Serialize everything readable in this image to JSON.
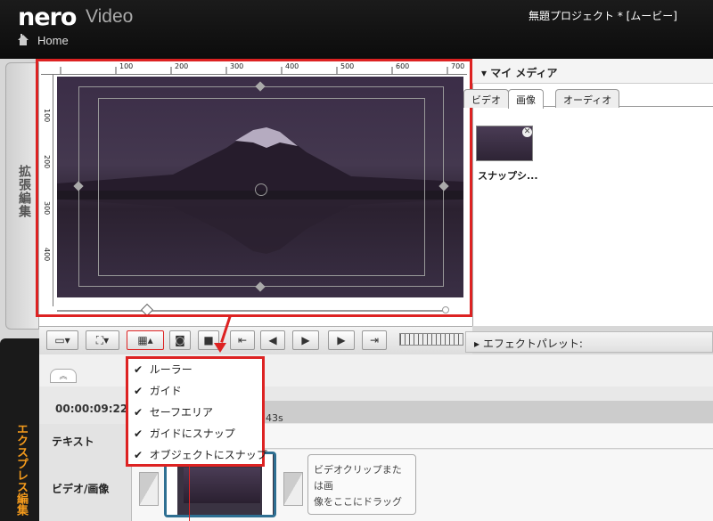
{
  "app": {
    "logo_brand": "nero",
    "logo_product": "Video",
    "project_title": "無題プロジェクト * [ムービー]",
    "home_label": "Home"
  },
  "side_tabs": {
    "top_label": "拡張編集",
    "bottom_label": "エクスプレス編集"
  },
  "preview": {
    "ruler_top_ticks": [
      "100",
      "200",
      "300",
      "400",
      "500",
      "600",
      "700"
    ],
    "ruler_left_ticks": [
      "100",
      "200",
      "300",
      "400"
    ]
  },
  "media": {
    "header": "マイ メディア",
    "tabs": [
      {
        "label": "ビデオ",
        "active": false
      },
      {
        "label": "画像",
        "active": true
      },
      {
        "label": "オーディオ",
        "active": false
      }
    ],
    "items": [
      {
        "label": "スナップシ..."
      }
    ]
  },
  "effects": {
    "label": "エフェクトパレット:"
  },
  "timeline": {
    "timecode": "00:00:09:22",
    "ruler_time": "43s",
    "tracks": [
      "テキスト",
      "ビデオ/画像"
    ],
    "drop_hint_line1": "ビデオクリップまたは画",
    "drop_hint_line2": "像をここにドラッグ"
  },
  "context_menu": {
    "items": [
      {
        "label": "ルーラー",
        "checked": true
      },
      {
        "label": "ガイド",
        "checked": true
      },
      {
        "label": "セーフエリア",
        "checked": true
      },
      {
        "label": "ガイドにスナップ",
        "checked": true
      },
      {
        "label": "オブジェクトにスナップ",
        "checked": true
      }
    ]
  },
  "colors": {
    "accent": "#dd2222",
    "tab_highlight": "#f39a1c",
    "clip_border": "#2e6f92"
  }
}
